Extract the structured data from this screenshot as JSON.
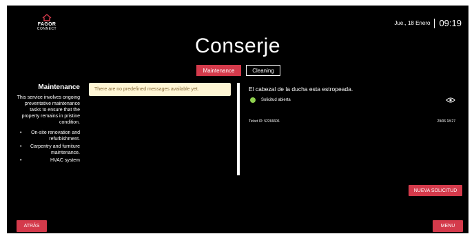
{
  "brand": {
    "name": "FAGOR",
    "sub": "CONNECT"
  },
  "header": {
    "date": "Jue., 18 Enero",
    "time": "09:19"
  },
  "page": {
    "title": "Conserje"
  },
  "tabs": [
    {
      "label": "Maintenance",
      "active": true
    },
    {
      "label": "Cleaning",
      "active": false
    }
  ],
  "sidebar": {
    "title": "Maintenance",
    "description": "This service involves ongoing preventative maintenance tasks to ensure that the property remains in pristine condition.",
    "items": [
      "On-site renovation and refurbishment.",
      "Carpentry and furniture maintenance.",
      "HVAC system"
    ]
  },
  "messages": {
    "empty_notice": "There are no predefined messages available yet."
  },
  "ticket": {
    "title": "El cabezal de la ducha esta estropeada.",
    "status": "Solicitud abierta",
    "status_color": "#8fd14f",
    "id": "Ticket ID: 52266606",
    "date": "29/06 18:27",
    "icon": "eye-icon"
  },
  "buttons": {
    "new_request": "NUEVA SOLICITUD",
    "back": "ATRÁS",
    "menu": "MENU"
  },
  "colors": {
    "accent": "#d43a4b",
    "background": "#000000",
    "warning_bg": "#fff6d5",
    "warning_text": "#8a6d3b"
  }
}
